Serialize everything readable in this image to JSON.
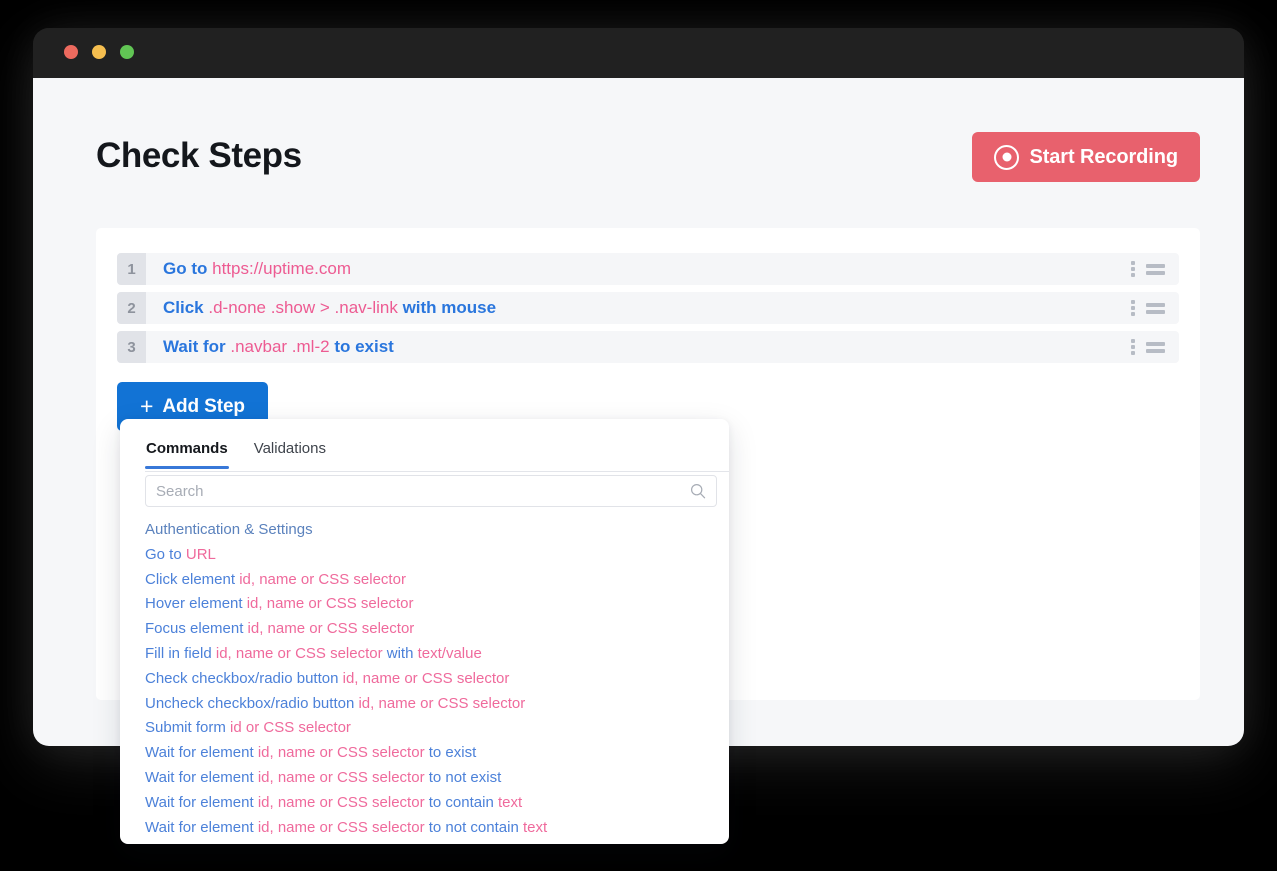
{
  "window": {
    "traffic_lights": [
      "close-red",
      "minimize-yellow",
      "maximize-green"
    ]
  },
  "header": {
    "title": "Check Steps",
    "record_button": {
      "label": "Start Recording",
      "icon": "record-icon",
      "color": "#E8616D"
    }
  },
  "steps": [
    {
      "number": "1",
      "parts": [
        {
          "text": "Go to ",
          "type": "keyword"
        },
        {
          "text": "https://uptime.com",
          "type": "param"
        }
      ]
    },
    {
      "number": "2",
      "parts": [
        {
          "text": "Click ",
          "type": "keyword"
        },
        {
          "text": ".d-none .show > .nav-link ",
          "type": "param"
        },
        {
          "text": "with mouse",
          "type": "keyword"
        }
      ]
    },
    {
      "number": "3",
      "parts": [
        {
          "text": "Wait for ",
          "type": "keyword"
        },
        {
          "text": ".navbar .ml-2 ",
          "type": "param"
        },
        {
          "text": "to exist",
          "type": "keyword"
        }
      ]
    }
  ],
  "add_step_button": {
    "label": "Add Step",
    "plus": "+",
    "color": "#1273D5"
  },
  "command_panel": {
    "tabs": [
      {
        "label": "Commands",
        "active": true
      },
      {
        "label": "Validations",
        "active": false
      }
    ],
    "search": {
      "placeholder": "Search",
      "value": "",
      "icon": "search-icon"
    },
    "items": [
      {
        "group": true,
        "parts": [
          {
            "text": "Authentication & Settings",
            "type": "group"
          }
        ]
      },
      {
        "parts": [
          {
            "text": "Go to ",
            "type": "keyword"
          },
          {
            "text": "URL",
            "type": "param"
          }
        ]
      },
      {
        "parts": [
          {
            "text": "Click element ",
            "type": "keyword"
          },
          {
            "text": "id, name or CSS selector",
            "type": "param"
          }
        ]
      },
      {
        "parts": [
          {
            "text": "Hover element ",
            "type": "keyword"
          },
          {
            "text": "id, name or CSS selector",
            "type": "param"
          }
        ]
      },
      {
        "parts": [
          {
            "text": "Focus element ",
            "type": "keyword"
          },
          {
            "text": "id, name or CSS selector",
            "type": "param"
          }
        ]
      },
      {
        "parts": [
          {
            "text": "Fill in field ",
            "type": "keyword"
          },
          {
            "text": "id, name or CSS selector ",
            "type": "param"
          },
          {
            "text": "with ",
            "type": "keyword"
          },
          {
            "text": "text/value",
            "type": "param"
          }
        ]
      },
      {
        "parts": [
          {
            "text": "Check checkbox/radio button ",
            "type": "keyword"
          },
          {
            "text": "id, name or CSS selector",
            "type": "param"
          }
        ]
      },
      {
        "parts": [
          {
            "text": "Uncheck checkbox/radio button ",
            "type": "keyword"
          },
          {
            "text": "id, name or CSS selector",
            "type": "param"
          }
        ]
      },
      {
        "parts": [
          {
            "text": "Submit form ",
            "type": "keyword"
          },
          {
            "text": "id or CSS selector",
            "type": "param"
          }
        ]
      },
      {
        "parts": [
          {
            "text": "Wait for element ",
            "type": "keyword"
          },
          {
            "text": "id, name or CSS selector ",
            "type": "param"
          },
          {
            "text": "to exist",
            "type": "keyword"
          }
        ]
      },
      {
        "parts": [
          {
            "text": "Wait for element ",
            "type": "keyword"
          },
          {
            "text": "id, name or CSS selector ",
            "type": "param"
          },
          {
            "text": "to not exist",
            "type": "keyword"
          }
        ]
      },
      {
        "parts": [
          {
            "text": "Wait for element ",
            "type": "keyword"
          },
          {
            "text": "id, name or CSS selector ",
            "type": "param"
          },
          {
            "text": "to contain ",
            "type": "keyword"
          },
          {
            "text": "text",
            "type": "param"
          }
        ]
      },
      {
        "parts": [
          {
            "text": "Wait for element ",
            "type": "keyword"
          },
          {
            "text": "id, name or CSS selector ",
            "type": "param"
          },
          {
            "text": "to not contain ",
            "type": "keyword"
          },
          {
            "text": "text",
            "type": "param"
          }
        ]
      }
    ]
  }
}
